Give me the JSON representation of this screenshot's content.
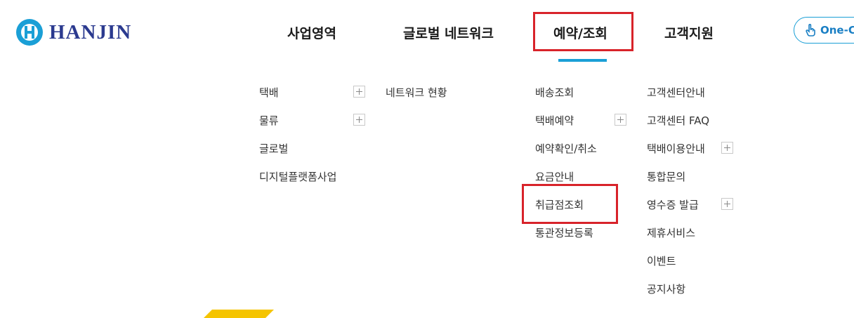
{
  "brand": {
    "name": "HANJIN",
    "colors": {
      "primary": "#2b3a8f",
      "accent": "#1a9fd6",
      "highlight": "#d8232a",
      "yellow": "#f5c400"
    }
  },
  "gnb": [
    {
      "label": "사업영역"
    },
    {
      "label": "글로벌 네트워크"
    },
    {
      "label": "예약/조회"
    },
    {
      "label": "고객지원"
    }
  ],
  "one_button": {
    "label": "One-C",
    "icon": "hand-pointer-icon"
  },
  "submenu": {
    "business": [
      "택배",
      "물류",
      "글로벌",
      "디지털플랫폼사업"
    ],
    "network": [
      "네트워크 현황"
    ],
    "reservation": [
      "배송조회",
      "택배예약",
      "예약확인/취소",
      "요금안내",
      "취급점조회",
      "통관정보등록"
    ],
    "support": [
      "고객센터안내",
      "고객센터 FAQ",
      "택배이용안내",
      "통합문의",
      "영수증 발급",
      "제휴서비스",
      "이벤트",
      "공지사항"
    ]
  }
}
